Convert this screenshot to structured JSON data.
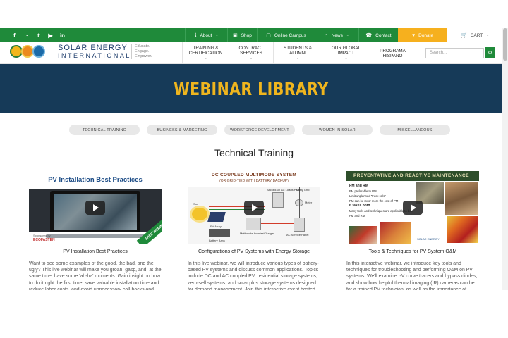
{
  "topbar": {
    "social": [
      {
        "icon": "facebook-icon",
        "glyph": "f"
      },
      {
        "icon": "rss-icon",
        "glyph": "◔"
      },
      {
        "icon": "twitter-icon",
        "glyph": "t"
      },
      {
        "icon": "youtube-icon",
        "glyph": "▶"
      },
      {
        "icon": "linkedin-icon",
        "glyph": "in"
      }
    ],
    "about": "About",
    "shop": "Shop",
    "online_campus": "Online Campus",
    "news": "News",
    "contact": "Contact",
    "donate": "Donate",
    "cart": "CART",
    "colors": {
      "green": "#1f8a3a",
      "gold": "#f6b01e"
    }
  },
  "header": {
    "logo_name": "SOLAR ENERGY",
    "logo_intl": "INTERNATIONAL",
    "tagline": [
      "Educate.",
      "Engage.",
      "Empower."
    ],
    "nav": [
      {
        "line1": "TRAINING &",
        "line2": "CERTIFICATION"
      },
      {
        "line1": "CONTRACT SERVICES",
        "line2": ""
      },
      {
        "line1": "STUDENTS & ALUMNI",
        "line2": ""
      },
      {
        "line1": "OUR GLOBAL IMPACT",
        "line2": ""
      },
      {
        "line1": "PROGRAMA HISPANO",
        "line2": ""
      }
    ],
    "search_placeholder": "Search..."
  },
  "hero": {
    "title": "WEBINAR LIBRARY",
    "colors": {
      "bg": "#163a58",
      "text": "#efb51e"
    }
  },
  "filters": [
    "TECHNICAL TRAINING",
    "BUSINESS & MARKETING",
    "WORKFORCE DEVELOPMENT",
    "WOMEN IN SOLAR",
    "MISCELLANEOUS"
  ],
  "section_title": "Technical Training",
  "cards": [
    {
      "title": "PV Installation Best Practices",
      "thumb": {
        "title": "PV Installation Best Practices",
        "sponsor": "Sponsored by",
        "brand": "ECOFASTEN",
        "badge": "FREE WEBINAR"
      },
      "description": "Want to see some examples of the good, the bad, and the ugly? This live webinar will make you groan, gasp, and, at the same time, have some 'ah-ha' moments. Gain insight on how to do it right the first time, save valuable installation time and reduce labor costs, and avoid unnecessary call-backs and red-tags from your AHJ. A fun-filled interactive presentation on residential, commercial, and utility-scale PV"
    },
    {
      "title": "Configurations of PV Systems with Energy Storage",
      "thumb": {
        "title": "DC COUPLED MULTIMODE SYSTEM",
        "subtitle": "(OR GRID-TIED WITH BATTERY BACKUP)",
        "labels": [
          "PV Array",
          "Battery Bank",
          "Multimode Inverter/Charger",
          "Utility Grid",
          "Meter",
          "AC Service Panel",
          "Backed-up AC Loads Panel",
          "Sun"
        ]
      },
      "description": "In this live webinar, we will introduce various types of battery-based PV systems and discuss common applications. Topics include DC and AC coupled PV, residential storage systems, zero-sell systems, and solar plus storage systems designed for demand management. Join this interactive event hosted by SEI instructors with decades of experience to learn more about battery-based"
    },
    {
      "title": "Tools & Techniques for PV System O&M",
      "thumb": {
        "title": "PREVENTATIVE AND REACTIVE MAINTENANCE",
        "list": [
          "PM and RM",
          "PM preferable to RM",
          "Limit unplanned \"truck-rolls\"",
          "RM can be 3x or more the cost of PM",
          "It takes both",
          "Many tools and techniques are applicable to both PM and RM"
        ]
      },
      "description": "In this interactive webinar, we introduce key tools and techniques for troubleshooting and performing O&M on PV systems. We'll examine I-V curve tracers and bypass diodes, and show how helpful thermal imaging (IR) cameras can be for a trained PV technician, as well as the importance of performing insulation resistance testing on all conductors. And we'll finish with a quick review of how to locate ground"
    }
  ]
}
